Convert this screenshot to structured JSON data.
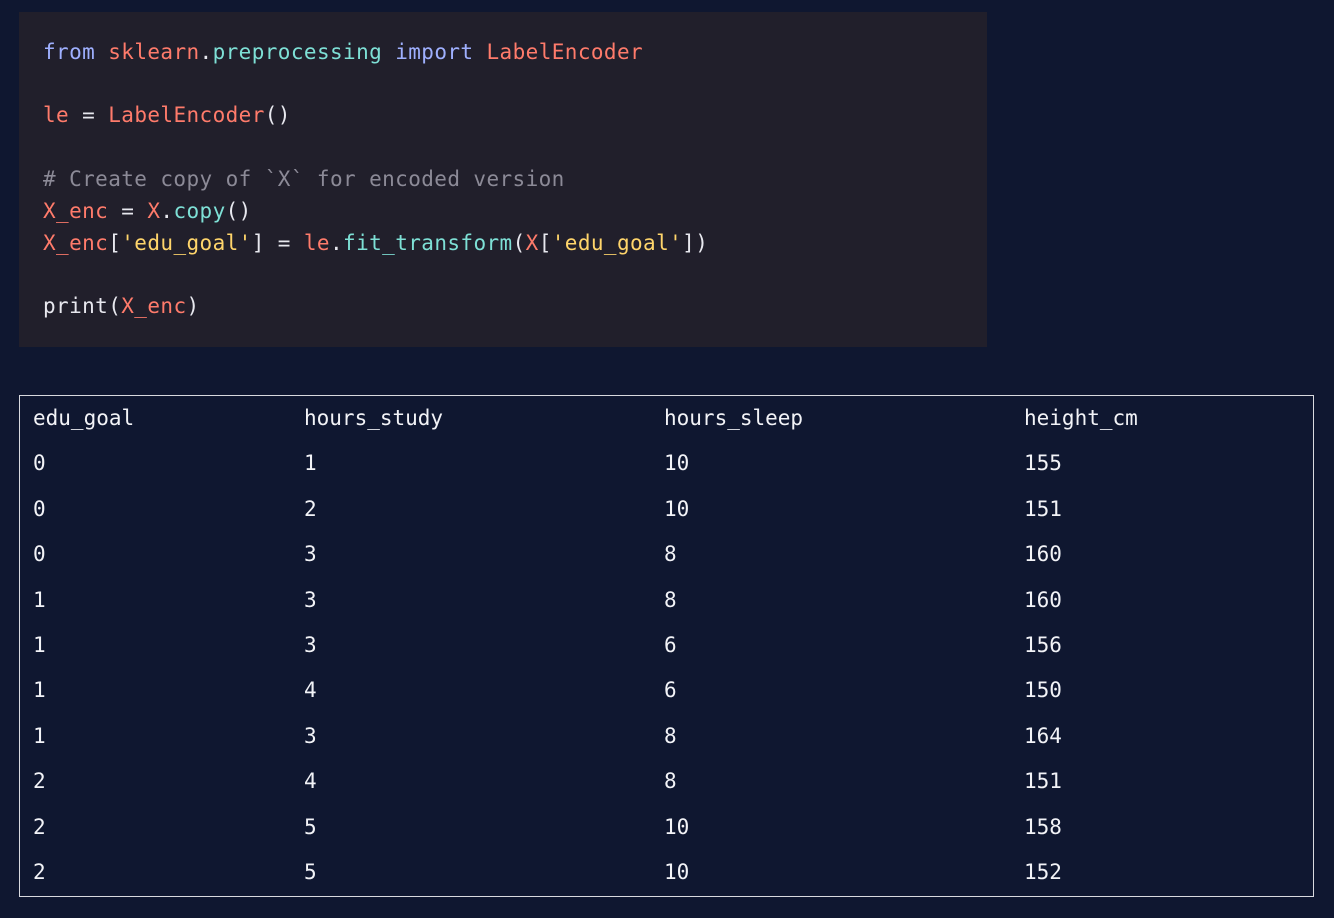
{
  "code": {
    "line1": {
      "kw_from": "from",
      "module": "sklearn",
      "dot": ".",
      "submodule": "preprocessing",
      "kw_import": "import",
      "class": "LabelEncoder"
    },
    "line2": {
      "var": "le",
      "eq": " = ",
      "class": "LabelEncoder",
      "parens": "()"
    },
    "line3": {
      "comment": "# Create copy of `X` for encoded version"
    },
    "line4": {
      "var": "X_enc",
      "eq": " = ",
      "obj": "X",
      "dot": ".",
      "method": "copy",
      "parens": "()"
    },
    "line5": {
      "var": "X_enc",
      "open": "[",
      "key": "'edu_goal'",
      "close_eq": "] = ",
      "obj": "le",
      "dot": ".",
      "method": "fit_transform",
      "open2": "(",
      "arg": "X",
      "open3": "[",
      "key2": "'edu_goal'",
      "close2": "])"
    },
    "line6": {
      "func": "print(",
      "arg": "X_enc",
      "close": ")"
    }
  },
  "table": {
    "headers": [
      "edu_goal",
      "hours_study",
      "hours_sleep",
      "height_cm"
    ],
    "rows": [
      [
        "0",
        "1",
        "10",
        "155"
      ],
      [
        "0",
        "2",
        "10",
        "151"
      ],
      [
        "0",
        "3",
        "8",
        "160"
      ],
      [
        "1",
        "3",
        "8",
        "160"
      ],
      [
        "1",
        "3",
        "6",
        "156"
      ],
      [
        "1",
        "4",
        "6",
        "150"
      ],
      [
        "1",
        "3",
        "8",
        "164"
      ],
      [
        "2",
        "4",
        "8",
        "151"
      ],
      [
        "2",
        "5",
        "10",
        "158"
      ],
      [
        "2",
        "5",
        "10",
        "152"
      ]
    ]
  }
}
